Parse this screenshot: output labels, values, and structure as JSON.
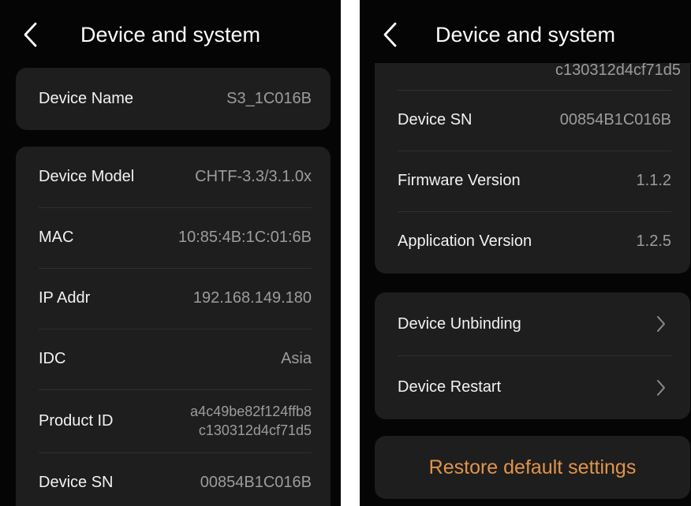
{
  "left": {
    "title": "Device and system",
    "name_row": {
      "label": "Device Name",
      "value": "S3_1C016B"
    },
    "info_rows": [
      {
        "label": "Device Model",
        "value": "CHTF-3.3/3.1.0x"
      },
      {
        "label": "MAC",
        "value": "10:85:4B:1C:01:6B"
      },
      {
        "label": "IP Addr",
        "value": "192.168.149.180"
      },
      {
        "label": "IDC",
        "value": "Asia"
      },
      {
        "label": "Product ID",
        "value_line1": "a4c49be82f124ffb8",
        "value_line2": "c130312d4cf71d5"
      },
      {
        "label": "Device SN",
        "value": "00854B1C016B"
      }
    ]
  },
  "right": {
    "title": "Device and system",
    "clipped_value": "c130312d4cf71d5",
    "info_rows": [
      {
        "label": "Device SN",
        "value": "00854B1C016B"
      },
      {
        "label": "Firmware Version",
        "value": "1.1.2"
      },
      {
        "label": "Application Version",
        "value": "1.2.5"
      }
    ],
    "actions": [
      {
        "label": "Device Unbinding"
      },
      {
        "label": "Device Restart"
      }
    ],
    "restore_label": "Restore default settings"
  },
  "icons": {
    "back": "chevron-left-icon",
    "arrow": "chevron-right-icon"
  },
  "colors": {
    "background": "#050505",
    "card": "#1e1e1e",
    "accent": "#e2934a",
    "value_text": "#9c9c9c"
  }
}
